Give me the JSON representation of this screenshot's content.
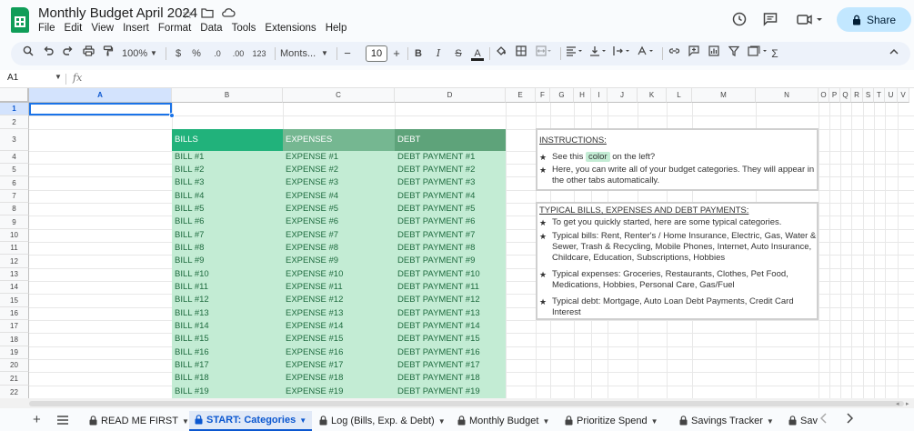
{
  "document": {
    "title": "Monthly Budget April 2024",
    "menu": [
      "File",
      "Edit",
      "View",
      "Insert",
      "Format",
      "Data",
      "Tools",
      "Extensions",
      "Help"
    ],
    "share_label": "Share"
  },
  "toolbar": {
    "zoom": "100%",
    "currency": "$",
    "percent": "%",
    "dec_decrease": ".0",
    "dec_increase": ".00",
    "number_format": "123",
    "font_name": "Monts...",
    "font_size": "10",
    "minus": "−",
    "plus": "+",
    "bold": "B",
    "italic": "I",
    "strike": "S",
    "text_color": "A",
    "sum": "Σ"
  },
  "formula_bar": {
    "cell_ref": "A1",
    "fx": "fx",
    "value": ""
  },
  "columns": [
    "A",
    "B",
    "C",
    "D",
    "E",
    "F",
    "G",
    "H",
    "I",
    "J",
    "K",
    "L",
    "M",
    "N",
    "O",
    "P",
    "Q",
    "R",
    "S",
    "T",
    "U",
    "V"
  ],
  "rows": [
    "1",
    "2",
    "3",
    "4",
    "5",
    "6",
    "7",
    "8",
    "9",
    "10",
    "11",
    "12",
    "13",
    "14",
    "15",
    "16",
    "17",
    "18",
    "19",
    "20",
    "21",
    "22"
  ],
  "categories": {
    "headers": [
      "BILLS",
      "EXPENSES",
      "DEBT"
    ],
    "header_colors": [
      "#21b27b",
      "#75b791",
      "#5ea37a"
    ],
    "bills": [
      "BILL #1",
      "BILL #2",
      "BILL #3",
      "BILL #4",
      "BILL #5",
      "BILL #6",
      "BILL #7",
      "BILL #8",
      "BILL #9",
      "BILL #10",
      "BILL #11",
      "BILL #12",
      "BILL #13",
      "BILL #14",
      "BILL #15",
      "BILL #16",
      "BILL #17",
      "BILL #18",
      "BILL #19"
    ],
    "expenses": [
      "EXPENSE #1",
      "EXPENSE #2",
      "EXPENSE #3",
      "EXPENSE #4",
      "EXPENSE #5",
      "EXPENSE #6",
      "EXPENSE #7",
      "EXPENSE #8",
      "EXPENSE #9",
      "EXPENSE #10",
      "EXPENSE #11",
      "EXPENSE #12",
      "EXPENSE #13",
      "EXPENSE #14",
      "EXPENSE #15",
      "EXPENSE #16",
      "EXPENSE #17",
      "EXPENSE #18",
      "EXPENSE #19"
    ],
    "debts": [
      "DEBT PAYMENT #1",
      "DEBT PAYMENT #2",
      "DEBT PAYMENT #3",
      "DEBT PAYMENT #4",
      "DEBT PAYMENT #5",
      "DEBT PAYMENT #6",
      "DEBT PAYMENT #7",
      "DEBT PAYMENT #8",
      "DEBT PAYMENT #9",
      "DEBT PAYMENT #10",
      "DEBT PAYMENT #11",
      "DEBT PAYMENT #12",
      "DEBT PAYMENT #13",
      "DEBT PAYMENT #14",
      "DEBT PAYMENT #15",
      "DEBT PAYMENT #16",
      "DEBT PAYMENT #17",
      "DEBT PAYMENT #18",
      "DEBT PAYMENT #19"
    ]
  },
  "instructions": {
    "title": "INSTRUCTIONS:",
    "b1_pre": "See this",
    "b1_chip": "color",
    "b1_post": "on the left?",
    "b2": "Here, you can write all of your budget categories. They will appear in the other tabs automatically."
  },
  "typical": {
    "title": "TYPICAL BILLS, EXPENSES AND DEBT PAYMENTS:",
    "b1": "To get you quickly started, here are some typical categories.",
    "b2": "Typical bills: Rent, Renter's / Home Insurance, Electric, Gas, Water & Sewer, Trash & Recycling, Mobile Phones, Internet, Auto Insurance, Childcare, Education, Subscriptions, Hobbies",
    "b3": "Typical expenses: Groceries, Restaurants, Clothes, Pet Food, Medications, Hobbies, Personal Care, Gas/Fuel",
    "b4": "Typical debt: Mortgage, Auto Loan Debt Payments, Credit Card Interest"
  },
  "tabs": [
    {
      "label": "READ ME FIRST",
      "active": false
    },
    {
      "label": "START: Categories",
      "active": true
    },
    {
      "label": "Log (Bills, Exp. & Debt)",
      "active": false
    },
    {
      "label": "Monthly Budget",
      "active": false
    },
    {
      "label": "Prioritize Spend",
      "active": false
    },
    {
      "label": "Savings Tracker",
      "active": false
    },
    {
      "label": "Sav",
      "active": false
    }
  ],
  "colors": {
    "accent": "#0b57d0",
    "share_bg": "#c2e7ff",
    "category_fill": "#c3ecd4",
    "logo": "#0f9d58"
  }
}
